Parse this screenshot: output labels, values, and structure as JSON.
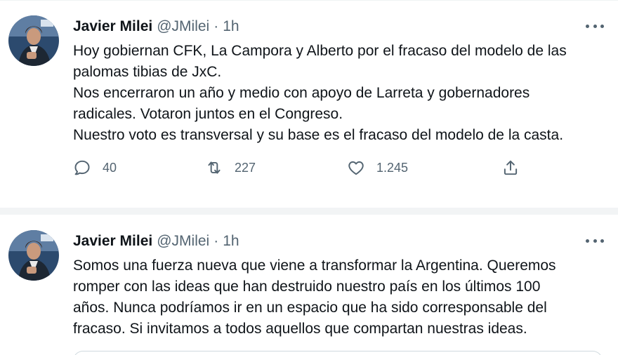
{
  "tweets": [
    {
      "author": {
        "name": "Javier Milei",
        "handle": "@JMilei"
      },
      "separator": "·",
      "time": "1h",
      "text_lines": [
        "Hoy gobiernan CFK, La Campora y Alberto por el fracaso del modelo de las",
        "palomas tibias de JxC.",
        "Nos encerraron un año y medio con apoyo de Larreta y gobernadores",
        "radicales. Votaron juntos en el Congreso.",
        "Nuestro voto es transversal y su base es el fracaso del modelo de la casta."
      ],
      "stats": {
        "replies": "40",
        "retweets": "227",
        "likes": "1.245"
      },
      "icons": [
        "reply-icon",
        "retweet-icon",
        "like-icon",
        "share-icon",
        "more-icon"
      ]
    },
    {
      "author": {
        "name": "Javier Milei",
        "handle": "@JMilei"
      },
      "separator": "·",
      "time": "1h",
      "text_lines": [
        "Somos una fuerza nueva que viene a transformar la Argentina. Queremos",
        "romper con las ideas que han destruido nuestro país en los últimos 100",
        "años. Nunca podríamos ir en un espacio que ha sido corresponsable del",
        "fracaso. Si invitamos a todos aquellos que compartan nuestras ideas."
      ]
    }
  ],
  "colors": {
    "text": "#0f1419",
    "secondary": "#536471",
    "border": "#cfd9de",
    "divider": "#f2f4f5"
  }
}
